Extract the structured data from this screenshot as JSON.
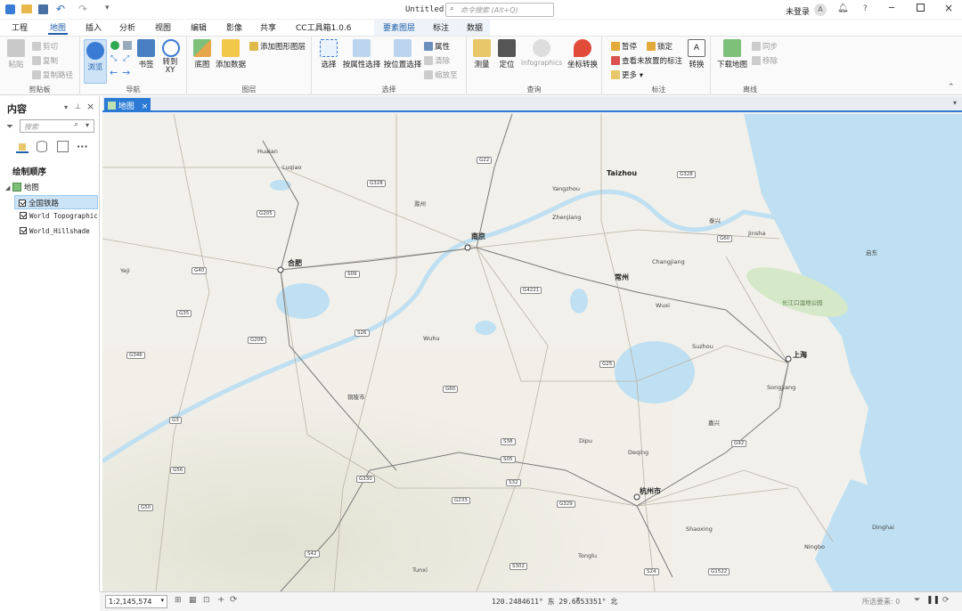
{
  "window": {
    "title": "Untitled",
    "search_placeholder": "命令搜索 (Alt+Q)",
    "user": "未登录",
    "user_initial": "A",
    "help": "?"
  },
  "menu": {
    "tabs": [
      "工程",
      "地图",
      "插入",
      "分析",
      "视图",
      "编辑",
      "影像",
      "共享",
      "CC工具箱1.0.6",
      "标注",
      "数据"
    ],
    "active": "地图",
    "context_group": "要素图层"
  },
  "ribbon": {
    "clipboard": {
      "label": "剪贴板",
      "paste": "粘贴",
      "cut": "剪切",
      "copy": "复制",
      "copy_path": "复制路径"
    },
    "navigate": {
      "label": "导航",
      "explore": "浏览",
      "bookmarks": "书签",
      "goto": "转到 XY"
    },
    "layer": {
      "label": "图层",
      "basemap": "底图",
      "add_data": "添加数据",
      "add_graphics": "添加图形图层"
    },
    "selection": {
      "label": "选择",
      "select": "选择",
      "by_attr": "按属性选择",
      "by_loc": "按位置选择",
      "attributes": "属性",
      "clear": "清除",
      "zoom_to": "缩放至"
    },
    "inquiry": {
      "label": "查询",
      "measure": "测量",
      "locate": "定位",
      "infographics": "Infographics",
      "coord_convert": "坐标转换"
    },
    "labeling": {
      "label": "标注",
      "pause": "暂停",
      "lock": "锁定",
      "view_unplaced": "查看未放置的标注",
      "more": "更多",
      "convert": "转换"
    },
    "offline": {
      "label": "离线",
      "download_map": "下载地图",
      "sync": "同步",
      "remove": "移除"
    }
  },
  "contents": {
    "title": "内容",
    "search_placeholder": "搜索",
    "drawing_order": "绘制顺序",
    "map_name": "地图",
    "layers": [
      {
        "name": "全国铁路",
        "checked": true,
        "selected": true
      },
      {
        "name": "World Topographic",
        "checked": true,
        "selected": false
      },
      {
        "name": "World_Hillshade",
        "checked": true,
        "selected": false
      }
    ]
  },
  "map_view": {
    "tab_label": "地图"
  },
  "map_labels": {
    "cities": [
      "南京",
      "合肥",
      "常州",
      "上海",
      "杭州市",
      "Taizhou"
    ],
    "places": [
      "Huaian",
      "Luqiao",
      "滁州",
      "Yangzhou",
      "Zhenjiang",
      "泰兴",
      "Jinsha",
      "Changjiang",
      "Wuxi",
      "Suzhou",
      "Songjiang",
      "嘉兴",
      "Wuhu",
      "铜陵市",
      "Yeji",
      "Dipu",
      "Deqing",
      "Shaoxing",
      "Ningbo",
      "Dinghai",
      "Tunxi",
      "Tonglu",
      "长江口湿地公园",
      "启东"
    ],
    "roads": [
      "G328",
      "G22",
      "G205",
      "G40",
      "G35",
      "G206",
      "S09",
      "S26",
      "G4221",
      "G328",
      "G25",
      "G50",
      "G92",
      "S05",
      "G330",
      "G233",
      "G329",
      "G60",
      "S42",
      "S302",
      "S24",
      "G1522",
      "G346",
      "G3",
      "G56",
      "S32",
      "S38",
      "G60"
    ]
  },
  "status": {
    "scale": "1:2,145,574",
    "coordinates": "120.2484611° 东  29.6653351° 北",
    "selected_features": "所选要素: 0"
  }
}
